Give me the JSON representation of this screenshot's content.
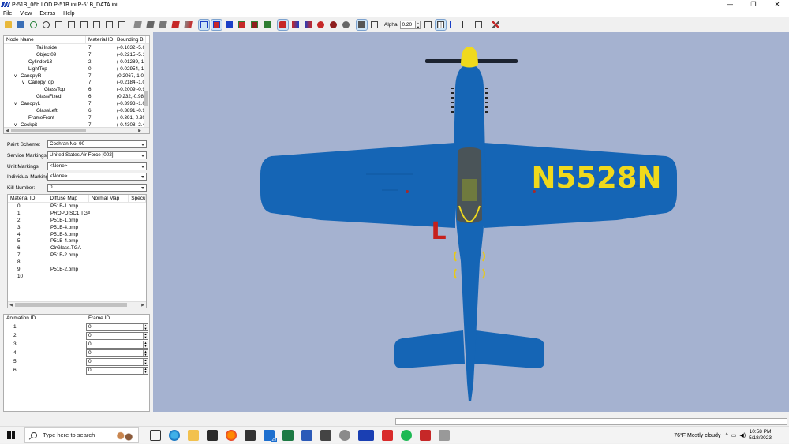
{
  "titlebar": {
    "title": "P-51B_06b.LOD  P-51B.ini  P-51B_DATA.ini",
    "minimize": "—",
    "maximize": "❐",
    "close": "✕"
  },
  "menu": [
    "File",
    "View",
    "Extras",
    "Help"
  ],
  "toolbar": {
    "alpha_label": "Alpha:",
    "alpha_value": "0.20",
    "spin_up": "▲",
    "spin_down": "▼"
  },
  "node_tree": {
    "columns": [
      "Node Name",
      "Material ID",
      "Bounding B"
    ],
    "rows": [
      {
        "indent": 3,
        "exp": "",
        "name": "TailInside",
        "mat": "7",
        "bb": "(-0.1032,-5.6"
      },
      {
        "indent": 3,
        "exp": "",
        "name": "Object09",
        "mat": "7",
        "bb": "(-0.2215,-5.1"
      },
      {
        "indent": 2,
        "exp": "",
        "name": "Cylinder13",
        "mat": "2",
        "bb": "(-0.01289,-1."
      },
      {
        "indent": 2,
        "exp": "",
        "name": "LightTop",
        "mat": "0",
        "bb": "(-0.02954,-1."
      },
      {
        "indent": 1,
        "exp": "v",
        "name": "CanopyR",
        "mat": "7",
        "bb": "(0.2067,-1.01"
      },
      {
        "indent": 2,
        "exp": "v",
        "name": "CanopyTop",
        "mat": "7",
        "bb": "(-0.2184,-1.0"
      },
      {
        "indent": 4,
        "exp": "",
        "name": "GlassTop",
        "mat": "6",
        "bb": "(-0.2009,-0.9"
      },
      {
        "indent": 3,
        "exp": "",
        "name": "GlassFixed",
        "mat": "6",
        "bb": "(0.232,-0.989"
      },
      {
        "indent": 1,
        "exp": "v",
        "name": "CanopyL",
        "mat": "7",
        "bb": "(-0.3993,-1.0"
      },
      {
        "indent": 3,
        "exp": "",
        "name": "GlassLeft",
        "mat": "6",
        "bb": "(-0.3891,-0.9"
      },
      {
        "indent": 2,
        "exp": "",
        "name": "FrameFront",
        "mat": "7",
        "bb": "(-0.391,-0.30"
      },
      {
        "indent": 1,
        "exp": "v",
        "name": "Cockpit",
        "mat": "7",
        "bb": "(-0.4308,-2.4"
      }
    ]
  },
  "markings": {
    "paint_scheme": {
      "label": "Paint Scheme:",
      "value": "Cochran No. 90"
    },
    "service_markings": {
      "label": "Service Markings:",
      "value": "United States Air Force [002]"
    },
    "unit_markings": {
      "label": "Unit Markings:",
      "value": "<None>"
    },
    "individual_markings": {
      "label": "Individual Markings:",
      "value": "<None>"
    },
    "kill_number": {
      "label": "Kill Number:",
      "value": "0"
    }
  },
  "materials": {
    "columns": [
      "Material ID",
      "Diffuse Map",
      "Normal Map",
      "Specu"
    ],
    "rows": [
      {
        "id": "0",
        "diffuse": "P51B-1.bmp"
      },
      {
        "id": "1",
        "diffuse": "PROPDISC1.TGA"
      },
      {
        "id": "2",
        "diffuse": "P51B-1.bmp"
      },
      {
        "id": "3",
        "diffuse": "P51B-4.bmp"
      },
      {
        "id": "4",
        "diffuse": "P51B-3.bmp"
      },
      {
        "id": "5",
        "diffuse": "P51B-4.bmp"
      },
      {
        "id": "6",
        "diffuse": "ClrGlass.TGA"
      },
      {
        "id": "7",
        "diffuse": "P51B-2.bmp"
      },
      {
        "id": "8",
        "diffuse": ""
      },
      {
        "id": "9",
        "diffuse": "P51B-2.bmp"
      },
      {
        "id": "10",
        "diffuse": ""
      }
    ]
  },
  "animation": {
    "columns": [
      "Animation ID",
      "Frame ID"
    ],
    "rows": [
      {
        "id": "1",
        "frame": "0"
      },
      {
        "id": "2",
        "frame": "0"
      },
      {
        "id": "3",
        "frame": "0"
      },
      {
        "id": "4",
        "frame": "0"
      },
      {
        "id": "5",
        "frame": "0"
      },
      {
        "id": "6",
        "frame": "0"
      }
    ]
  },
  "aircraft": {
    "registration": "N5528N",
    "letter": "L",
    "body_color": "#1565b5",
    "text_color": "#f0d91c",
    "letter_color": "#c6201c"
  },
  "taskbar": {
    "search_placeholder": "Type here to search",
    "badge": "29",
    "weather": "76°F  Mostly cloudy",
    "time": "10:58 PM",
    "date": "5/18/2023"
  }
}
